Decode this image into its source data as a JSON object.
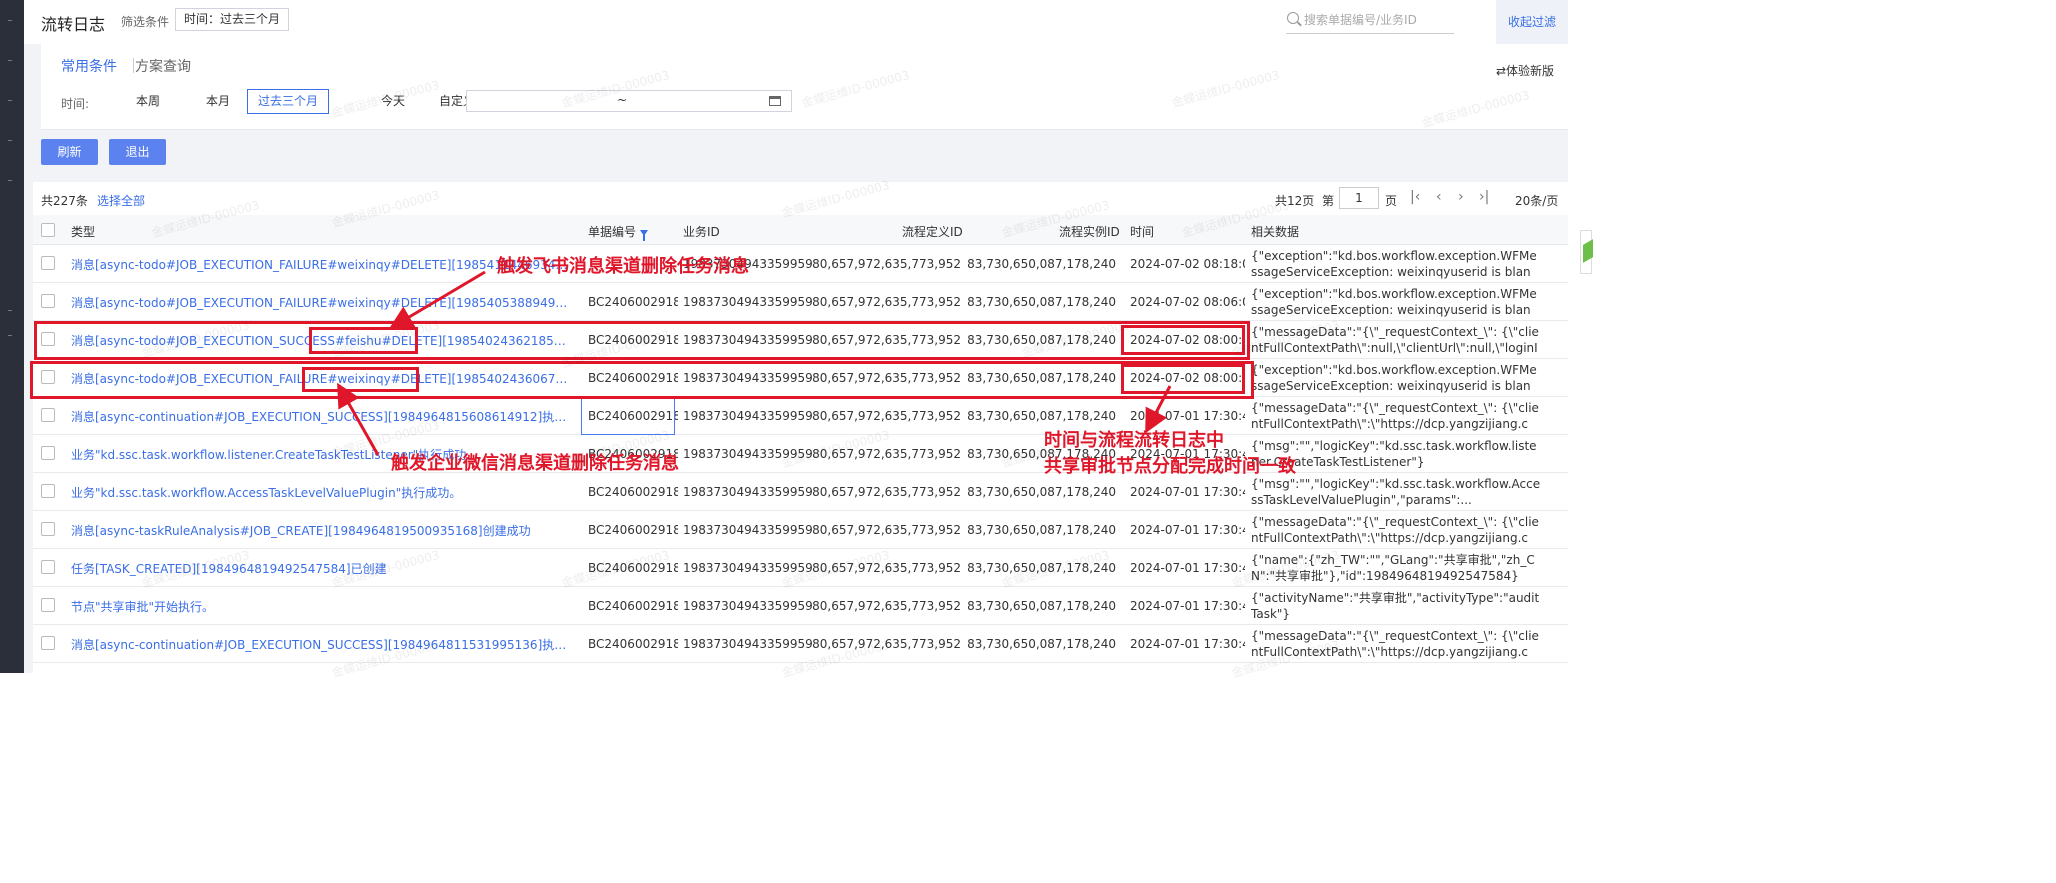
{
  "header": {
    "title": "流转日志",
    "filter_label": "筛选条件",
    "filter_tag": "时间：过去三个月",
    "search_placeholder": "搜索单据编号/业务ID",
    "collapse_label": "收起过滤"
  },
  "conditions": {
    "tab_common": "常用条件",
    "tab_scheme": "方案查询",
    "new_version": "⇄体验新版",
    "time_label": "时间:",
    "time_options": [
      "本周",
      "本月",
      "过去三个月",
      "今天",
      "自定义"
    ],
    "time_selected": "过去三个月",
    "date_range_separator": "~"
  },
  "actions": {
    "refresh": "刷新",
    "exit": "退出"
  },
  "list": {
    "total": "共227条",
    "select_all": "选择全部",
    "pages_total": "共12页",
    "page_pre": "第",
    "page_current": "1",
    "page_post": "页",
    "page_size": "20条/页",
    "columns": [
      "类型",
      "单据编号",
      "业务ID",
      "流程定义ID",
      "流程实例ID",
      "时间",
      "相关数据"
    ],
    "rows": [
      {
        "type": "消息[async-todo#JOB_EXECUTION_FAILURE#weixinqy#DELETE][1985411446934...执行失败",
        "bill": "",
        "biz": "1983730494335995904",
        "def": "1,980,657,972,635,773,952",
        "inst": "1,983,730,650,087,178,240",
        "time": "2024-07-02 08:18:09",
        "data": "{\"exception\":\"kd.bos.workflow.exception.WFMessageServiceException: weixinqyuserid is blank:[null]..."
      },
      {
        "type": "消息[async-todo#JOB_EXECUTION_FAILURE#weixinqy#DELETE][1985405388949838848]执...",
        "bill": "BC2406002918",
        "biz": "1983730494335995904",
        "def": "1,980,657,972,635,773,952",
        "inst": "1,983,730,650,087,178,240",
        "time": "2024-07-02 08:06:07",
        "data": "{\"exception\":\"kd.bos.workflow.exception.WFMessageServiceException: weixinqyuserid is blank:[null]..."
      },
      {
        "type": "消息[async-todo#JOB_EXECUTION_SUCCESS#feishu#DELETE][1985402436218546176]执行...",
        "bill": "BC2406002918",
        "biz": "1983730494335995904",
        "def": "1,980,657,972,635,773,952",
        "inst": "1,983,730,650,087,178,240",
        "time": "2024-07-02 08:00:15",
        "data": "{\"messageData\":\"{\\\"_requestContext_\\\": {\\\"clientFullContextPath\\\":null,\\\"clientUrl\\\":null,\\\"loginIp..."
      },
      {
        "type": "消息[async-todo#JOB_EXECUTION_FAILURE#weixinqy#DELETE][1985402436067552256]执...",
        "bill": "BC2406002918",
        "biz": "1983730494335995904",
        "def": "1,980,657,972,635,773,952",
        "inst": "1,983,730,650,087,178,240",
        "time": "2024-07-02 08:00:14",
        "data": "{\"exception\":\"kd.bos.workflow.exception.WFMessageServiceException: weixinqyuserid is blank:[null]..."
      },
      {
        "type": "消息[async-continuation#JOB_EXECUTION_SUCCESS][1984964815608614912]执行成功",
        "bill": "BC2406002918",
        "biz": "1983730494335995904",
        "def": "1,980,657,972,635,773,952",
        "inst": "1,983,730,650,087,178,240",
        "time": "2024-07-01 17:30:46",
        "data": "{\"messageData\":\"{\\\"_requestContext_\\\": {\\\"clientFullContextPath\\\":\\\"https://dcp.yangzijiang.co..."
      },
      {
        "type": "业务\"kd.ssc.task.workflow.listener.CreateTaskTestListener\"执行成功",
        "bill": "BC2406002918",
        "biz": "1983730494335995904",
        "def": "1,980,657,972,635,773,952",
        "inst": "1,983,730,650,087,178,240",
        "time": "2024-07-01 17:30:46",
        "data": "{\"msg\":\"\",\"logicKey\":\"kd.ssc.task.workflow.listener.CreateTaskTestListener\"}"
      },
      {
        "type": "业务\"kd.ssc.task.workflow.AccessTaskLevelValuePlugin\"执行成功。",
        "bill": "BC2406002918",
        "biz": "1983730494335995904",
        "def": "1,980,657,972,635,773,952",
        "inst": "1,983,730,650,087,178,240",
        "time": "2024-07-01 17:30:45",
        "data": "{\"msg\":\"\",\"logicKey\":\"kd.ssc.task.workflow.AccessTaskLevelValuePlugin\",\"params\":..."
      },
      {
        "type": "消息[async-taskRuleAnalysis#JOB_CREATE][1984964819500935168]创建成功",
        "bill": "BC2406002918",
        "biz": "1983730494335995904",
        "def": "1,980,657,972,635,773,952",
        "inst": "1,983,730,650,087,178,240",
        "time": "2024-07-01 17:30:45",
        "data": "{\"messageData\":\"{\\\"_requestContext_\\\": {\\\"clientFullContextPath\\\":\\\"https://dcp.yangzijiang.co..."
      },
      {
        "type": "任务[TASK_CREATED][1984964819492547584]已创建",
        "bill": "BC2406002918",
        "biz": "1983730494335995904",
        "def": "1,980,657,972,635,773,952",
        "inst": "1,983,730,650,087,178,240",
        "time": "2024-07-01 17:30:45",
        "data": "{\"name\":{\"zh_TW\":\"\",\"GLang\":\"共享审批\",\"zh_CN\":\"共享审批\"},\"id\":1984964819492547584}"
      },
      {
        "type": "节点\"共享审批\"开始执行。",
        "bill": "BC2406002918",
        "biz": "1983730494335995904",
        "def": "1,980,657,972,635,773,952",
        "inst": "1,983,730,650,087,178,240",
        "time": "2024-07-01 17:30:45",
        "data": "{\"activityName\":\"共享审批\",\"activityType\":\"auditTask\"}"
      },
      {
        "type": "消息[async-continuation#JOB_EXECUTION_SUCCESS][1984964811531995136]执行成功",
        "bill": "BC2406002918",
        "biz": "1983730494335995904",
        "def": "1,980,657,972,635,773,952",
        "inst": "1,983,730,650,087,178,240",
        "time": "2024-07-01 17:30:45",
        "data": "{\"messageData\":\"{\\\"_requestContext_\\\": {\\\"clientFullContextPath\\\":\\\"https://dcp.yangzijiang.co..."
      }
    ]
  },
  "annotations": {
    "feishu_note": "触发飞书消息渠道删除任务消息",
    "weixin_note": "触发企业微信消息渠道删除任务消息",
    "time_note_line1": "时间与流程流转日志中",
    "time_note_line2": "共享审批节点分配完成时间一致",
    "color": "#e0172a"
  },
  "watermark": "金蝶运维ID-000003"
}
